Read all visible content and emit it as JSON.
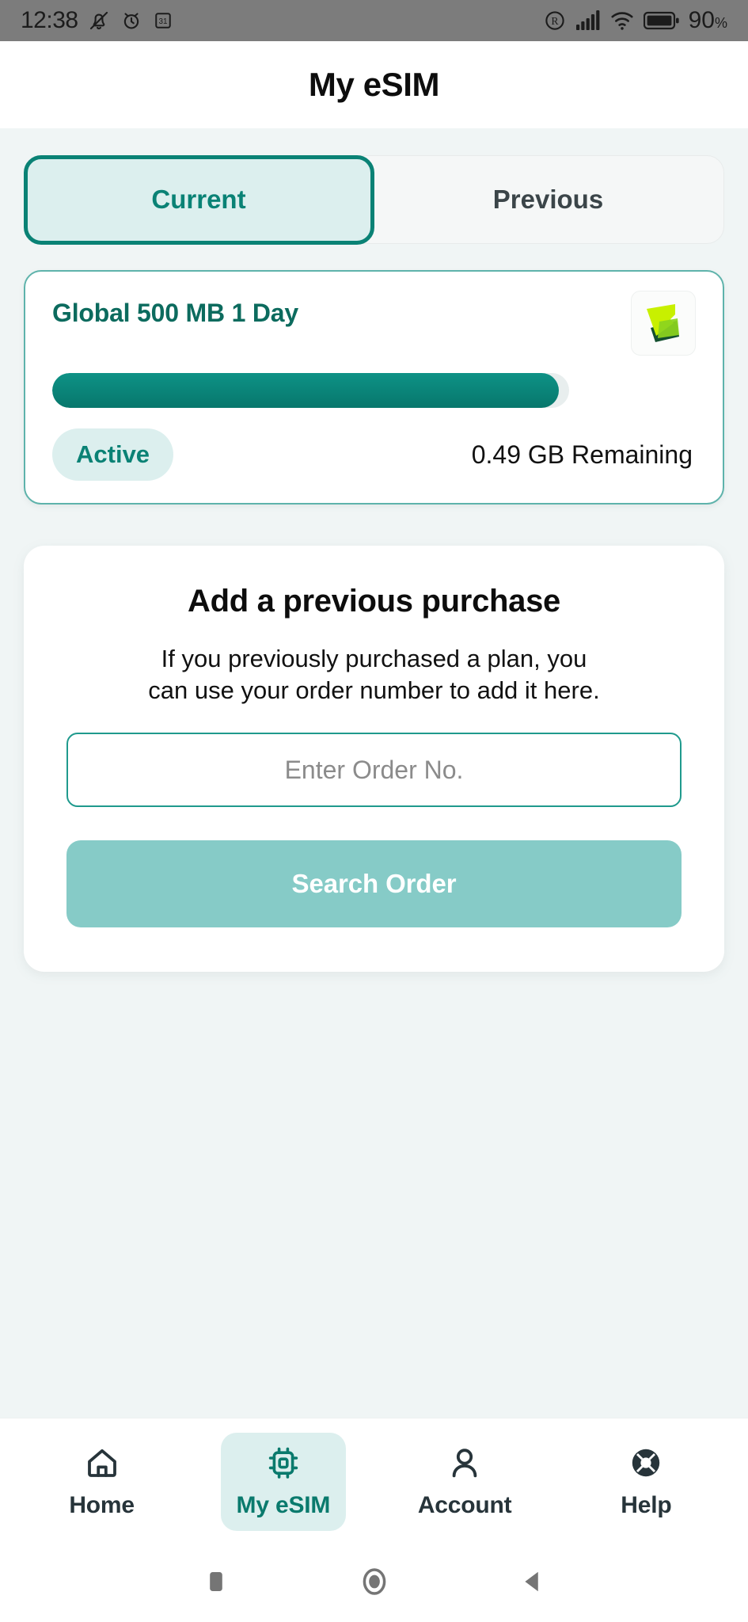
{
  "status_bar": {
    "time": "12:38",
    "icons_left": [
      "mute-icon",
      "alarm-icon",
      "calendar-icon"
    ],
    "icons_right": [
      "registered-icon",
      "cellular-signal-icon",
      "wifi-icon",
      "battery-icon"
    ],
    "battery_percent": "90",
    "battery_percent_symbol": "%",
    "background_color": "#7c7c7c"
  },
  "header": {
    "title": "My eSIM"
  },
  "tabs": {
    "items": [
      {
        "label": "Current",
        "active": true
      },
      {
        "label": "Previous",
        "active": false
      }
    ],
    "active_color": "#0a8275",
    "active_bg": "#dcefee",
    "inactive_color": "#3b4549"
  },
  "plan_card": {
    "title": "Global 500 MB 1 Day",
    "logo": "esim-provider-logo",
    "progress_percent": 98,
    "status_label": "Active",
    "remaining_label": "0.49 GB Remaining",
    "accent_color": "#0c6b5e",
    "progress_color": "#0a8275",
    "border_color": "#5eb3ab"
  },
  "purchase_card": {
    "title": "Add a previous purchase",
    "description_line1": "If you previously purchased a plan, you",
    "description_line2": "can use your order number to add it here.",
    "input_value": "",
    "input_placeholder": "Enter Order No.",
    "button_label": "Search Order",
    "button_color": "#86cbc7",
    "input_border_color": "#1f9a8d"
  },
  "bottom_nav": {
    "items": [
      {
        "label": "Home",
        "icon": "home-icon",
        "active": false
      },
      {
        "label": "My eSIM",
        "icon": "sim-chip-icon",
        "active": true
      },
      {
        "label": "Account",
        "icon": "person-icon",
        "active": false
      },
      {
        "label": "Help",
        "icon": "lifebuoy-icon",
        "active": false
      }
    ],
    "active_color": "#0a7a6d",
    "active_bg": "#dcefee",
    "inactive_color": "#27343a"
  },
  "system_nav": {
    "buttons": [
      {
        "name": "recents-button",
        "icon": "square-icon"
      },
      {
        "name": "home-button",
        "icon": "circle-icon"
      },
      {
        "name": "back-button",
        "icon": "triangle-left-icon"
      }
    ],
    "color": "#757575"
  }
}
